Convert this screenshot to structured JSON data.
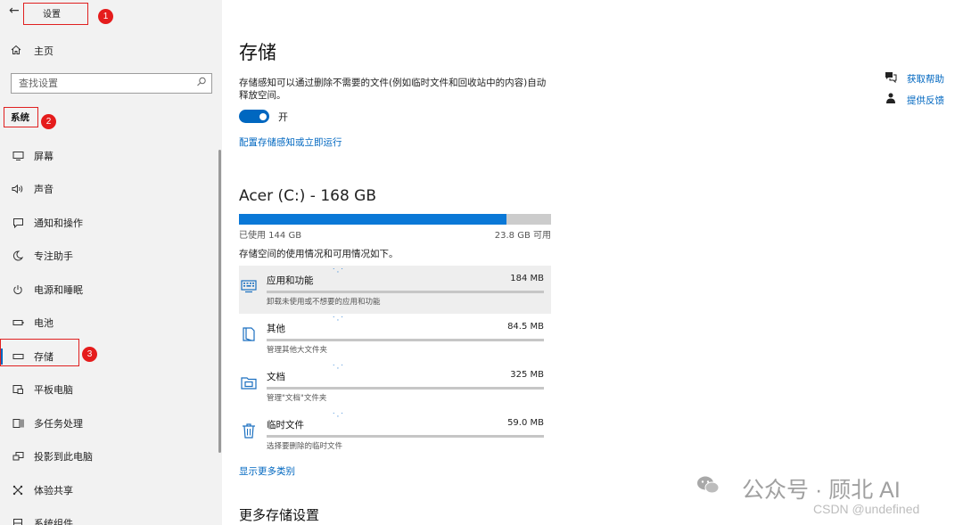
{
  "window": {
    "title": "设置"
  },
  "sidebar": {
    "home_label": "主页",
    "search_placeholder": "查找设置",
    "section_label": "系统",
    "items": [
      {
        "label": "屏幕",
        "icon": "monitor-icon"
      },
      {
        "label": "声音",
        "icon": "speaker-icon"
      },
      {
        "label": "通知和操作",
        "icon": "notification-icon"
      },
      {
        "label": "专注助手",
        "icon": "moon-icon"
      },
      {
        "label": "电源和睡眠",
        "icon": "power-icon"
      },
      {
        "label": "电池",
        "icon": "battery-icon"
      },
      {
        "label": "存储",
        "icon": "storage-icon",
        "selected": true
      },
      {
        "label": "平板电脑",
        "icon": "tablet-icon"
      },
      {
        "label": "多任务处理",
        "icon": "multitask-icon"
      },
      {
        "label": "投影到此电脑",
        "icon": "project-icon"
      },
      {
        "label": "体验共享",
        "icon": "share-icon"
      },
      {
        "label": "系统组件",
        "icon": "components-icon"
      }
    ]
  },
  "annotations": [
    "1",
    "2",
    "3"
  ],
  "main": {
    "title": "存储",
    "description": "存储感知可以通过删除不需要的文件(例如临时文件和回收站中的内容)自动释放空间。",
    "toggle_state": "开",
    "config_link": "配置存储感知或立即运行",
    "drive": {
      "title": "Acer (C:) - 168 GB",
      "used_label": "已使用 144 GB",
      "free_label": "23.8 GB 可用",
      "used_fraction": 0.857
    },
    "usage_intro": "存储空间的使用情况和可用情况如下。",
    "categories": [
      {
        "name": "应用和功能",
        "size": "184 MB",
        "sub": "卸载未使用或不想要的应用和功能",
        "icon": "apps-icon",
        "fraction": 0.0
      },
      {
        "name": "其他",
        "size": "84.5 MB",
        "sub": "管理其他大文件夹",
        "icon": "other-icon",
        "fraction": 0.0
      },
      {
        "name": "文档",
        "size": "325 MB",
        "sub": "管理\"文档\"文件夹",
        "icon": "documents-icon",
        "fraction": 0.0
      },
      {
        "name": "临时文件",
        "size": "59.0 MB",
        "sub": "选择要删除的临时文件",
        "icon": "trash-icon",
        "fraction": 0.0
      }
    ],
    "show_more": "显示更多类别",
    "more_settings_title": "更多存储设置"
  },
  "help": {
    "get_help": "获取帮助",
    "feedback": "提供反馈"
  },
  "watermark": {
    "text": "公众号 · 顾北 AI",
    "csdn": "CSDN @undefined"
  },
  "colors": {
    "accent": "#0067c0",
    "annotation": "#e51c1c"
  }
}
